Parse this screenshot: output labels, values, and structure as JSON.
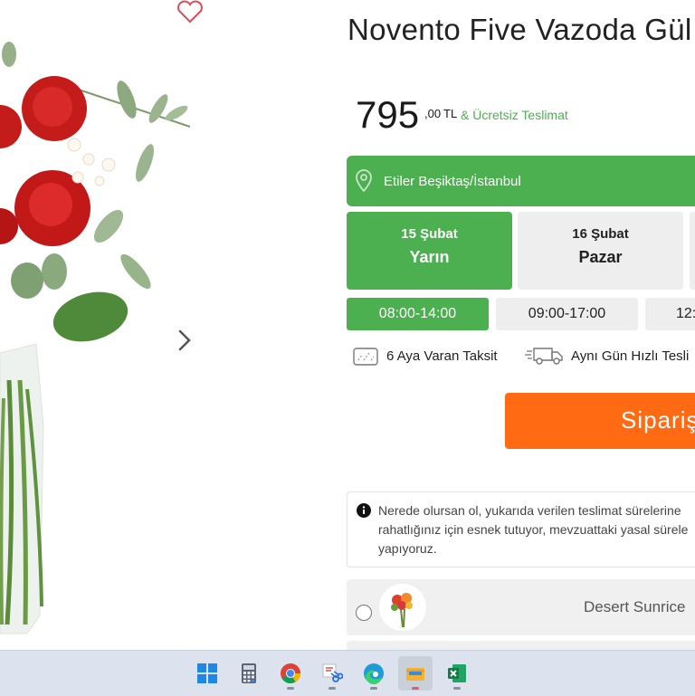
{
  "product": {
    "title": "Novento Five Vazoda Gül",
    "price_main": "795",
    "price_decimal": ",00",
    "currency": "TL",
    "free_delivery": "& Ücretsiz Teslimat"
  },
  "location": {
    "text": "Etiler  Beşiktaş/İstanbul",
    "icon": "map-pin-icon"
  },
  "dates": [
    {
      "date": "15 Şubat",
      "weekday": "Yarın",
      "selected": true
    },
    {
      "date": "16 Şubat",
      "weekday": "Pazar",
      "selected": false
    }
  ],
  "time_slots": [
    {
      "label": "08:00-14:00",
      "selected": true
    },
    {
      "label": "09:00-17:00",
      "selected": false
    },
    {
      "label": "12:",
      "selected": false
    }
  ],
  "features": [
    {
      "icon": "credit-card-icon",
      "label": "6 Aya Varan Taksit"
    },
    {
      "icon": "delivery-truck-icon",
      "label": "Aynı Gün Hızlı Tesli"
    }
  ],
  "order_button": {
    "label": "Sipariş"
  },
  "info": {
    "icon": "info-icon",
    "lines": [
      "Nerede olursan ol, yukarıda verilen teslimat sürelerine",
      "rahatlığınız için esnek tutuyor, mevzuattaki yasal sürele",
      "yapıyoruz."
    ]
  },
  "addons": [
    {
      "name": "Desert Sunrice "
    }
  ],
  "taskbar": {
    "items": [
      "windows-start-icon",
      "calculator-icon",
      "chrome-icon",
      "snipping-tool-icon",
      "edge-icon",
      "file-manager-icon",
      "excel-icon"
    ]
  },
  "colors": {
    "green": "#4caf50",
    "orange": "#ff6a13",
    "idle_gray": "#eeeeee"
  }
}
